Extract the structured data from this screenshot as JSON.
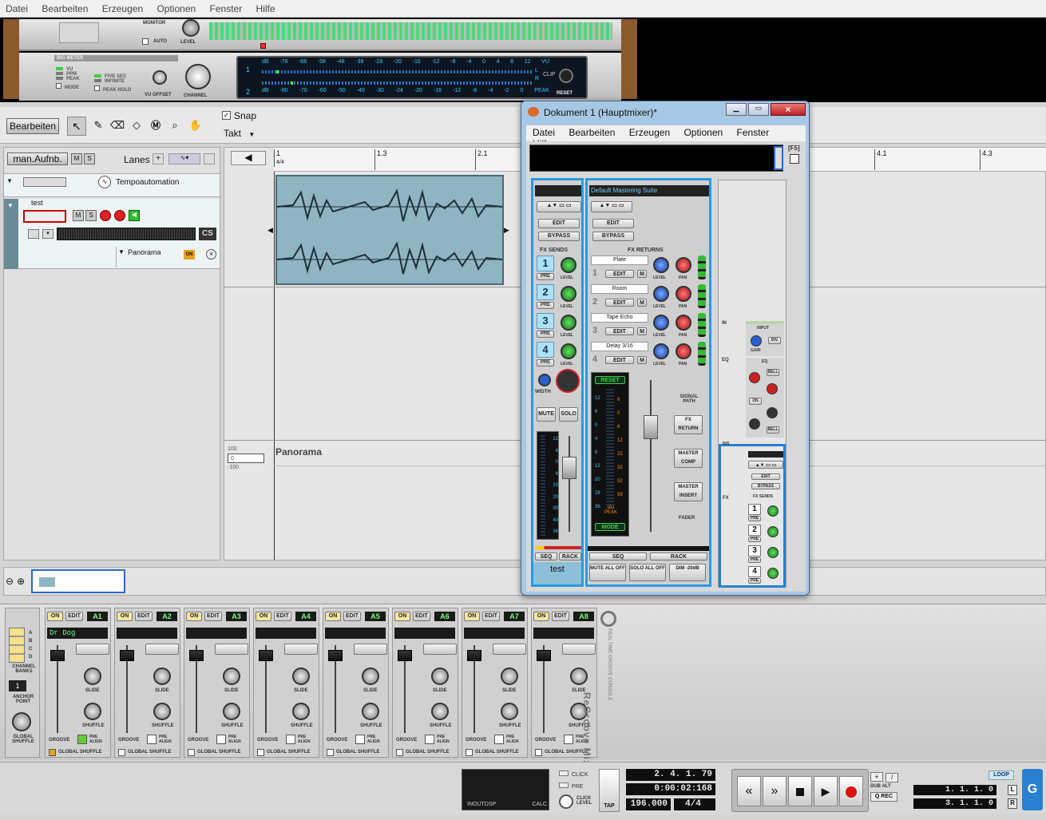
{
  "menubar": {
    "items": [
      "Datei",
      "Bearbeiten",
      "Erzeugen",
      "Optionen",
      "Fenster",
      "Hilfe"
    ]
  },
  "rack": {
    "monitor": "MONITOR",
    "auto": "AUTO",
    "level": "LEVEL",
    "big_meter": "BIG METER",
    "modes": [
      "VU",
      "PPM",
      "PEAK",
      "MODE"
    ],
    "holds": [
      "FIVE SEC",
      "INFINITE",
      "PEAK HOLD"
    ],
    "vu_offset": "VU OFFSET",
    "channel": "CHANNEL",
    "db_top": [
      "dB",
      "-78",
      "-68",
      "-58",
      "-48",
      "-38",
      "-28",
      "-20",
      "-16",
      "-12",
      "-8",
      "-4",
      "0",
      "4",
      "8",
      "12",
      "VU"
    ],
    "db_bottom": [
      "dB",
      "-80",
      "-70",
      "-60",
      "-50",
      "-40",
      "-30",
      "-24",
      "-20",
      "-16",
      "-12",
      "-8",
      "-4",
      "-2",
      "0",
      "PEAK"
    ],
    "ch1": "1",
    "ch2": "2",
    "L": "L",
    "R": "R",
    "clip": "CLIP",
    "reset": "RESET"
  },
  "toolbar": {
    "edit_label": "Bearbeiten",
    "snap_label": "Snap",
    "snap_value": "Takt"
  },
  "track_header": {
    "man_aufnb": "man.Aufnb.",
    "m": "M",
    "s": "S",
    "lanes": "Lanes",
    "tempo_label": "Tempoautomation",
    "track_name": "test",
    "cs": "CS",
    "panorama_label": "Panorama",
    "panorama_on": "ON"
  },
  "timeline": {
    "markers": [
      "1.3",
      "2.1",
      "4.1",
      "4.3"
    ],
    "first_bar": "1",
    "first_sig": "4/4"
  },
  "automation": {
    "lane_label": "Panorama",
    "max": "100",
    "value": "0",
    "min": "-100"
  },
  "mixer_window": {
    "title": "Dokument 1 (Hauptmixer)*",
    "menu": [
      "Datei",
      "Bearbeiten",
      "Erzeugen",
      "Optionen",
      "Fenster",
      "Hilfe"
    ],
    "f5": "[F5]",
    "mastering_suite": "Default Mastering Suite",
    "edit": "EDIT",
    "bypass": "BYPASS",
    "fx_sends": "FX SENDS",
    "fx_returns": "FX RETURNS",
    "pre": "PRE",
    "level": "LEVEL",
    "pan": "PAN",
    "m": "M",
    "sends": [
      "1",
      "2",
      "3",
      "4"
    ],
    "returns": [
      {
        "n": "1",
        "name": "Plate"
      },
      {
        "n": "2",
        "name": "Room"
      },
      {
        "n": "3",
        "name": "Tape Echo"
      },
      {
        "n": "4",
        "name": "Delay 3/16"
      }
    ],
    "width": "WIDTH",
    "mute": "MUTE",
    "solo": "SOLO",
    "meter_scale": [
      "12",
      "6",
      "0",
      "6",
      "10",
      "20",
      "30",
      "40",
      "36"
    ],
    "master_meter_left": [
      "12",
      "6",
      "0",
      "4",
      "8",
      "12",
      "20",
      "28",
      "36"
    ],
    "master_meter_right": [
      "6",
      "0",
      "6",
      "12",
      "22",
      "32",
      "52",
      "58"
    ],
    "reset": "RESET",
    "vu_peak": "VU PEAK",
    "mode": "MODE",
    "signal_path": "SIGNAL PATH",
    "fx_return_box": "FX RETURN",
    "master_comp": "MASTER COMP",
    "master_insert": "MASTER INSERT",
    "fader": "FADER",
    "seq": "SEQ",
    "rack": "RACK",
    "channel_name": "test",
    "mute_all": "MUTE ALL OFF",
    "solo_all": "SOLO ALL OFF",
    "dim": "DIM -20dB",
    "strip": {
      "in": "IN",
      "input": "INPUT",
      "gain": "GAIN",
      "inv": "INV",
      "eq": "EQ",
      "hf": "HF",
      "bell": "BELL",
      "on": "ON",
      "lf": "LF",
      "ins": "INS",
      "fx": "FX"
    }
  },
  "regroove": {
    "on": "ON",
    "edit": "EDIT",
    "channels": [
      {
        "id": "A1",
        "name": "Dr Dog"
      },
      {
        "id": "A2",
        "name": ""
      },
      {
        "id": "A3",
        "name": ""
      },
      {
        "id": "A4",
        "name": ""
      },
      {
        "id": "A5",
        "name": ""
      },
      {
        "id": "A6",
        "name": ""
      },
      {
        "id": "A7",
        "name": ""
      },
      {
        "id": "A8",
        "name": ""
      }
    ],
    "slide": "SLIDE",
    "shuffle": "SHUFFLE",
    "groove": "GROOVE",
    "pre_align": "PRE ALIGN",
    "global_shuffle_btn": "GLOBAL SHUFFLE",
    "banks": [
      "A",
      "B",
      "C",
      "D"
    ],
    "channel_banks": "CHANNEL BANKS",
    "anchor": "1",
    "anchor_point": "ANCHOR POINT",
    "global_shuffle": "GLOBAL SHUFFLE",
    "logo": "ReGroove Mixer",
    "logo_sub": "REAL TIME GROOVE CONSOLE"
  },
  "transport": {
    "dsp_labels": [
      "IN",
      "OUT",
      "DSP",
      "CALC"
    ],
    "click": "CLICK",
    "pre": "PRE",
    "click_level": "CLICK LEVEL",
    "tap": "TAP",
    "position": "2. 4. 1. 79",
    "time": "0:00:02:168",
    "tempo": "196.000",
    "signature": "4/4",
    "dub": "DUB",
    "alt": "ALT",
    "qrec": "Q REC",
    "loop": "LOOP",
    "left_loc": "1. 1. 1. 0",
    "right_loc": "3. 1. 1. 0",
    "L": "L",
    "R": "R"
  }
}
